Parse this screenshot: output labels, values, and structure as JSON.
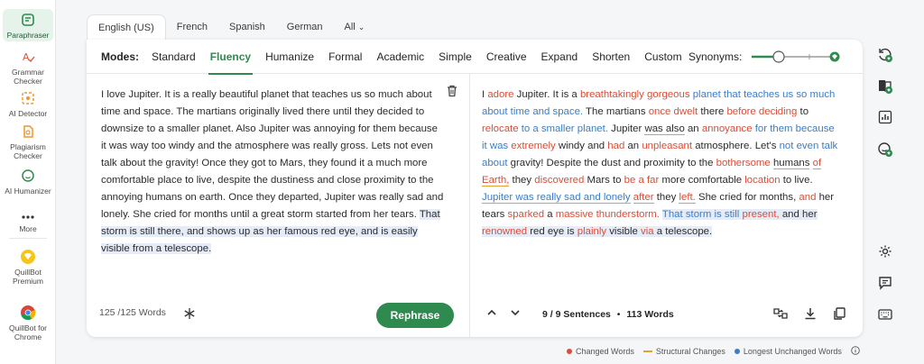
{
  "sidebar": {
    "items": [
      {
        "label": "Paraphraser",
        "icon": "paraphraser-icon"
      },
      {
        "label": "Grammar Checker",
        "icon": "grammar-checker-icon"
      },
      {
        "label": "AI Detector",
        "icon": "ai-detector-icon"
      },
      {
        "label": "Plagiarism Checker",
        "icon": "plagiarism-checker-icon"
      },
      {
        "label": "AI Humanizer",
        "icon": "ai-humanizer-icon"
      },
      {
        "label": "More",
        "icon": "more-icon"
      },
      {
        "label": "QuillBot Premium",
        "icon": "premium-diamond-icon"
      },
      {
        "label": "QuillBot for Chrome",
        "icon": "chrome-icon"
      }
    ]
  },
  "languages": {
    "tabs": [
      "English (US)",
      "French",
      "Spanish",
      "German"
    ],
    "all_label": "All",
    "active": "English (US)"
  },
  "modes": {
    "label": "Modes:",
    "items": [
      "Standard",
      "Fluency",
      "Humanize",
      "Formal",
      "Academic",
      "Simple",
      "Creative",
      "Expand",
      "Shorten",
      "Custom"
    ],
    "active": "Fluency",
    "synonyms_label": "Synonyms:"
  },
  "input": {
    "text_plain": "I love Jupiter. It is a really beautiful planet that teaches us so much about time and space. The martians originally lived there until they decided to downsize to a smaller planet. Also Jupiter was annoying for them because it was way too windy and the atmosphere was really gross. Lets not even talk about the gravity! Once they got to Mars, they found it a much more comfortable place to live, despite the dustiness and close proximity to the annoying humans on earth. Once they departed, Jupiter was really sad and lonely. She cried for months until a great storm started from her tears. ",
    "text_highlight": "That storm is still there, and shows up as her famous red eye, and is easily visible from a telescope.",
    "word_count": "125 /125 Words"
  },
  "output": {
    "segments": [
      {
        "t": "I ",
        "c": ""
      },
      {
        "t": "adore",
        "c": "chg"
      },
      {
        "t": " Jupiter. It is a ",
        "c": ""
      },
      {
        "t": "breathtakingly gorgeous",
        "c": "chg"
      },
      {
        "t": " ",
        "c": ""
      },
      {
        "t": "planet that teaches us so much about time and space.",
        "c": "unch"
      },
      {
        "t": " The martians ",
        "c": ""
      },
      {
        "t": "once dwelt",
        "c": "chg"
      },
      {
        "t": " there ",
        "c": ""
      },
      {
        "t": "before deciding",
        "c": "chg"
      },
      {
        "t": " to ",
        "c": ""
      },
      {
        "t": "relocate",
        "c": "chg"
      },
      {
        "t": " ",
        "c": ""
      },
      {
        "t": "to a smaller planet.",
        "c": "unch"
      },
      {
        "t": " Jupiter ",
        "c": ""
      },
      {
        "t": "was also",
        "c": "str"
      },
      {
        "t": " an ",
        "c": ""
      },
      {
        "t": "annoyance",
        "c": "chg"
      },
      {
        "t": " ",
        "c": ""
      },
      {
        "t": "for them because it was",
        "c": "unch"
      },
      {
        "t": " ",
        "c": ""
      },
      {
        "t": "extremely",
        "c": "chg"
      },
      {
        "t": " windy and ",
        "c": ""
      },
      {
        "t": "had",
        "c": "chg"
      },
      {
        "t": " an ",
        "c": ""
      },
      {
        "t": "unpleasant",
        "c": "chg"
      },
      {
        "t": " atmosphere. Let's ",
        "c": ""
      },
      {
        "t": "not even talk about",
        "c": "unch"
      },
      {
        "t": " gravity! Despite the dust and proximity to the ",
        "c": ""
      },
      {
        "t": "bothersome",
        "c": "chg"
      },
      {
        "t": " ",
        "c": ""
      },
      {
        "t": "humans",
        "c": "str"
      },
      {
        "t": " ",
        "c": ""
      },
      {
        "t": "of Earth,",
        "c": "chg str"
      },
      {
        "t": " they ",
        "c": ""
      },
      {
        "t": "discovered",
        "c": "chg"
      },
      {
        "t": " Mars to ",
        "c": ""
      },
      {
        "t": "be a",
        "c": "chg"
      },
      {
        "t": " ",
        "c": ""
      },
      {
        "t": "far",
        "c": "chg"
      },
      {
        "t": " more comfortable ",
        "c": ""
      },
      {
        "t": "location",
        "c": "chg"
      },
      {
        "t": " to live. ",
        "c": ""
      },
      {
        "t": "Jupiter was really sad and lonely",
        "c": "unch str"
      },
      {
        "t": " ",
        "c": ""
      },
      {
        "t": "after",
        "c": "chg str"
      },
      {
        "t": " they ",
        "c": ""
      },
      {
        "t": "left.",
        "c": "chg str"
      },
      {
        "t": " She cried for months, ",
        "c": ""
      },
      {
        "t": "and",
        "c": "chg"
      },
      {
        "t": " her tears ",
        "c": ""
      },
      {
        "t": "sparked",
        "c": "chg"
      },
      {
        "t": " a ",
        "c": ""
      },
      {
        "t": "massive thunderstorm.",
        "c": "chg"
      },
      {
        "t": " ",
        "c": ""
      },
      {
        "t": "That storm is still",
        "c": "unch hl"
      },
      {
        "t": " ",
        "c": "hl"
      },
      {
        "t": "present,",
        "c": "chg hl"
      },
      {
        "t": " and her ",
        "c": "hl"
      },
      {
        "t": "renowned",
        "c": "chg hl"
      },
      {
        "t": " red eye is ",
        "c": "hl"
      },
      {
        "t": "plainly",
        "c": "chg hl"
      },
      {
        "t": " visible ",
        "c": "hl"
      },
      {
        "t": "via",
        "c": "chg hl"
      },
      {
        "t": " a telescope.",
        "c": "hl"
      }
    ],
    "sentences": "9 / 9 Sentences",
    "bullet": "•",
    "words": "113 Words"
  },
  "actions": {
    "rephrase_label": "Rephrase"
  },
  "legend": {
    "changed": "Changed Words",
    "structural": "Structural Changes",
    "unchanged": "Longest Unchanged Words"
  },
  "colors": {
    "brand_green": "#2f8a4f",
    "changed": "#d94e38",
    "structural": "#e2a032",
    "unchanged": "#3b7dc7",
    "highlight": "#e5ecf8"
  }
}
